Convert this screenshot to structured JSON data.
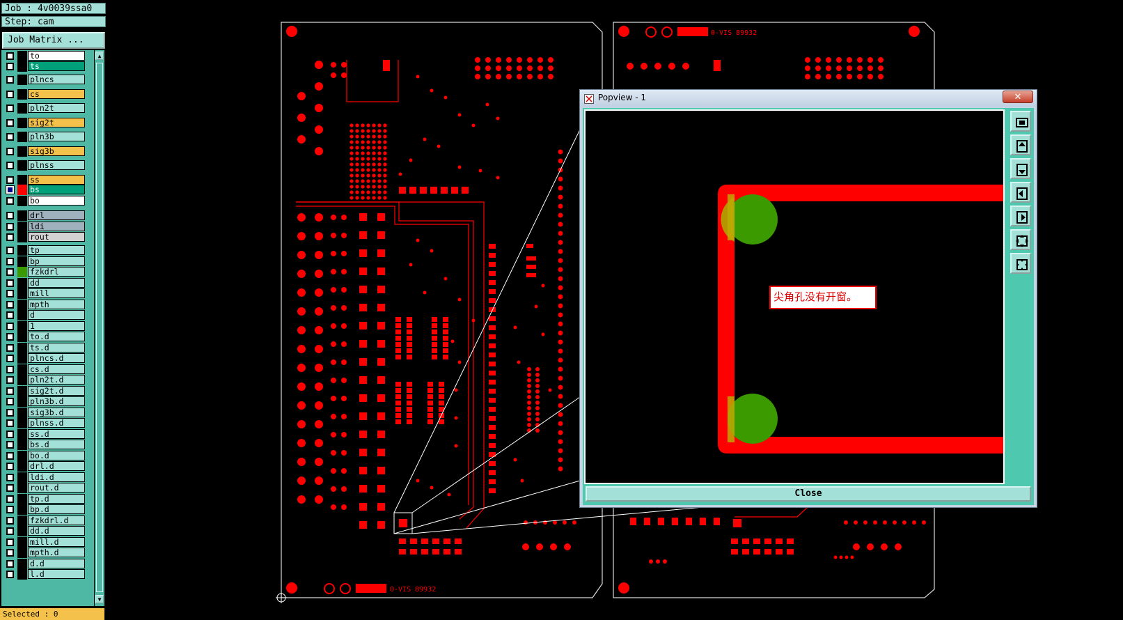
{
  "header": {
    "job": "Job : 4v0039ssa0",
    "step": "Step: cam"
  },
  "job_matrix_label": "Job Matrix ...",
  "colors": {
    "red": "#ff0000",
    "teal": "#4fb8a5",
    "light_teal": "#a3e0d8",
    "yellow": "#f4c14b",
    "green": "#00a07a",
    "drill_green": "#3a9a00"
  },
  "layers": [
    {
      "name": "to",
      "bg": "#ffffff"
    },
    {
      "name": "ts",
      "bg": "#00a07a",
      "fg": "#ffffff"
    },
    {
      "name": "plncs",
      "bg": "#a3e0d8"
    },
    {
      "name": "cs",
      "bg": "#f4c14b"
    },
    {
      "name": "pln2t",
      "bg": "#a3e0d8"
    },
    {
      "name": "sig2t",
      "bg": "#f4c14b"
    },
    {
      "name": "pln3b",
      "bg": "#a3e0d8"
    },
    {
      "name": "sig3b",
      "bg": "#f4c14b"
    },
    {
      "name": "plnss",
      "bg": "#a3e0d8"
    },
    {
      "name": "ss",
      "bg": "#f4c14b"
    },
    {
      "name": "bs",
      "bg": "#00a07a",
      "fg": "#ffffff",
      "active": true,
      "swatch": "#ff0000"
    },
    {
      "name": "bo",
      "bg": "#ffffff"
    },
    {
      "name": "drl",
      "bg": "#9fb1bd"
    },
    {
      "name": "ldi",
      "bg": "#9fb1bd"
    },
    {
      "name": "rout",
      "bg": "#d2d2d2"
    },
    {
      "name": "tp",
      "bg": "#a3e0d8"
    },
    {
      "name": "bp",
      "bg": "#a3e0d8"
    },
    {
      "name": "fzkdrl",
      "bg": "#a3e0d8",
      "swatch": "#3a9a00"
    },
    {
      "name": "dd",
      "bg": "#a3e0d8"
    },
    {
      "name": "mill",
      "bg": "#a3e0d8"
    },
    {
      "name": "mpth",
      "bg": "#a3e0d8"
    },
    {
      "name": "d",
      "bg": "#a3e0d8"
    },
    {
      "name": "1",
      "bg": "#a3e0d8"
    },
    {
      "name": "to.d",
      "bg": "#a3e0d8"
    },
    {
      "name": "ts.d",
      "bg": "#a3e0d8"
    },
    {
      "name": "plncs.d",
      "bg": "#a3e0d8"
    },
    {
      "name": "cs.d",
      "bg": "#a3e0d8"
    },
    {
      "name": "pln2t.d",
      "bg": "#a3e0d8"
    },
    {
      "name": "sig2t.d",
      "bg": "#a3e0d8"
    },
    {
      "name": "pln3b.d",
      "bg": "#a3e0d8"
    },
    {
      "name": "sig3b.d",
      "bg": "#a3e0d8"
    },
    {
      "name": "plnss.d",
      "bg": "#a3e0d8"
    },
    {
      "name": "ss.d",
      "bg": "#a3e0d8"
    },
    {
      "name": "bs.d",
      "bg": "#a3e0d8"
    },
    {
      "name": "bo.d",
      "bg": "#a3e0d8"
    },
    {
      "name": "drl.d",
      "bg": "#a3e0d8"
    },
    {
      "name": "ldi.d",
      "bg": "#a3e0d8"
    },
    {
      "name": "rout.d",
      "bg": "#a3e0d8"
    },
    {
      "name": "tp.d",
      "bg": "#a3e0d8"
    },
    {
      "name": "bp.d",
      "bg": "#a3e0d8"
    },
    {
      "name": "fzkdrl.d",
      "bg": "#a3e0d8"
    },
    {
      "name": "dd.d",
      "bg": "#a3e0d8"
    },
    {
      "name": "mill.d",
      "bg": "#a3e0d8"
    },
    {
      "name": "mpth.d",
      "bg": "#a3e0d8"
    },
    {
      "name": "d.d",
      "bg": "#a3e0d8"
    },
    {
      "name": "l.d",
      "bg": "#a3e0d8"
    }
  ],
  "status": {
    "selected": "Selected : 0"
  },
  "board": {
    "marking_text": "0-VIS 89932"
  },
  "popup": {
    "title": "Popview - 1",
    "close_x": "✕",
    "note": "尖角孔没有开窗。",
    "close_button": "Close",
    "tools": [
      "zoom-fit-icon",
      "pan-up-icon",
      "pan-down-icon",
      "pan-left-icon",
      "pan-right-icon",
      "zoom-in-icon",
      "zoom-out-icon"
    ]
  }
}
